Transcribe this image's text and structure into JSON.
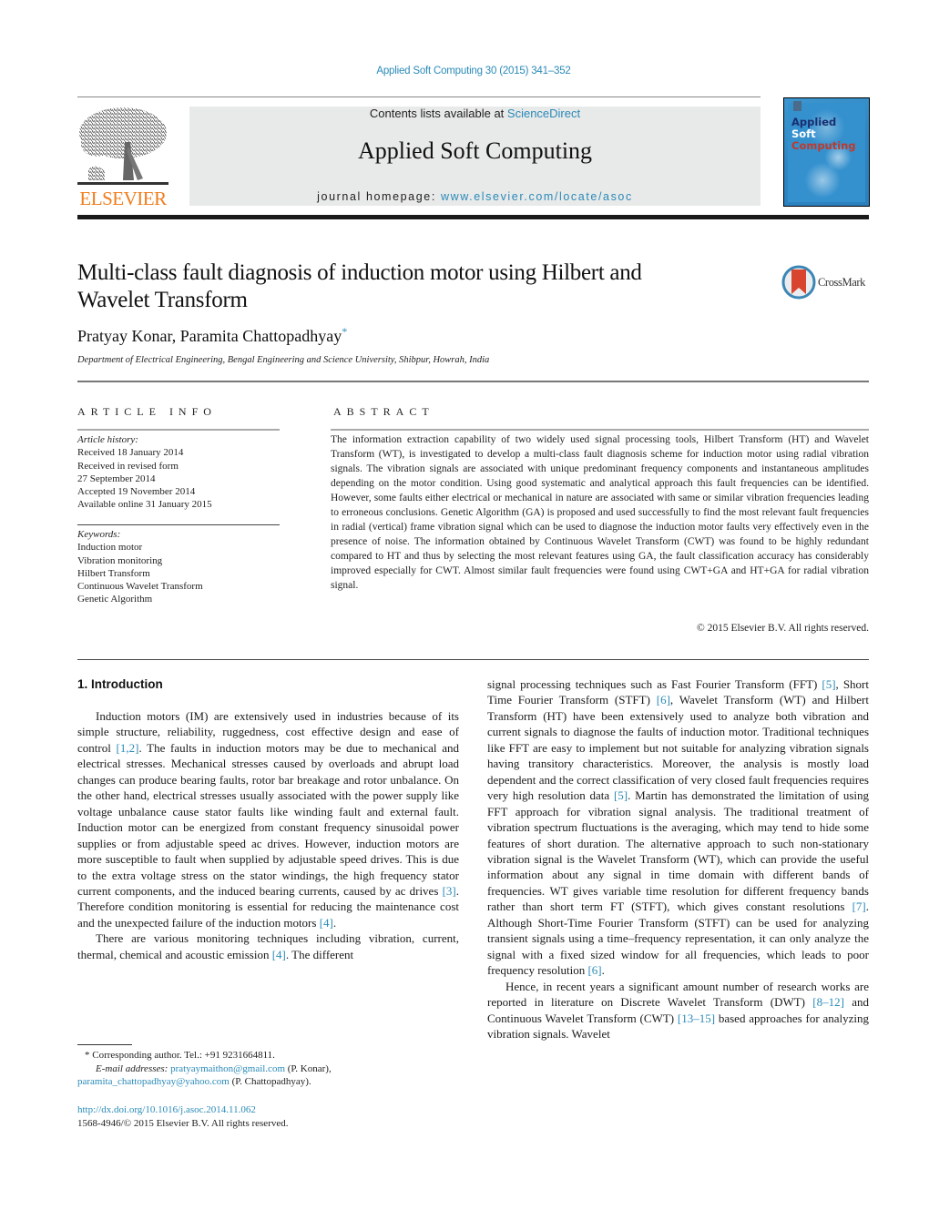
{
  "header": {
    "journal_reference": "Applied Soft Computing 30 (2015) 341–352",
    "contents_prefix": "Contents lists available at ",
    "contents_link": "ScienceDirect",
    "journal_name": "Applied Soft Computing",
    "homepage_prefix": "journal homepage: ",
    "homepage_link": "www.elsevier.com/locate/asoc",
    "publisher_logo_text": "ELSEVIER",
    "cover": {
      "line1": "Applied",
      "line2": "Soft",
      "line3": "Computing"
    },
    "crossmark_label": "CrossMark"
  },
  "article": {
    "title": "Multi-class fault diagnosis of induction motor using Hilbert and Wavelet Transform",
    "authors": "Pratyay Konar, Paramita Chattopadhyay",
    "corresponding_mark": "*",
    "affiliation": "Department of Electrical Engineering, Bengal Engineering and Science University, Shibpur, Howrah, India"
  },
  "article_info": {
    "heading": "ARTICLE INFO",
    "history_label": "Article history:",
    "history": [
      "Received 18 January 2014",
      "Received in revised form",
      "27 September 2014",
      "Accepted 19 November 2014",
      "Available online 31 January 2015"
    ],
    "keywords_label": "Keywords:",
    "keywords": [
      "Induction motor",
      "Vibration monitoring",
      "Hilbert Transform",
      "Continuous Wavelet Transform",
      "Genetic Algorithm"
    ]
  },
  "abstract": {
    "heading": "ABSTRACT",
    "text": "The information extraction capability of two widely used signal processing tools, Hilbert Transform (HT) and Wavelet Transform (WT), is investigated to develop a multi-class fault diagnosis scheme for induction motor using radial vibration signals. The vibration signals are associated with unique predominant frequency components and instantaneous amplitudes depending on the motor condition. Using good systematic and analytical approach this fault frequencies can be identified. However, some faults either electrical or mechanical in nature are associated with same or similar vibration frequencies leading to erroneous conclusions. Genetic Algorithm (GA) is proposed and used successfully to find the most relevant fault frequencies in radial (vertical) frame vibration signal which can be used to diagnose the induction motor faults very effectively even in the presence of noise. The information obtained by Continuous Wavelet Transform (CWT) was found to be highly redundant compared to HT and thus by selecting the most relevant features using GA, the fault classification accuracy has considerably improved especially for CWT. Almost similar fault frequencies were found using CWT+GA and HT+GA for radial vibration signal.",
    "copyright": "© 2015 Elsevier B.V. All rights reserved."
  },
  "body": {
    "section_heading": "1.  Introduction",
    "left_col": {
      "p1": [
        {
          "t": "Induction motors (IM) are extensively used in industries because of its simple structure, reliability, ruggedness, cost effective design and ease of control "
        },
        {
          "ref": "[1,2]"
        },
        {
          "t": ". The faults in induction motors may be due to mechanical and electrical stresses. Mechanical stresses caused by overloads and abrupt load changes can produce bearing faults, rotor bar breakage and rotor unbalance. On the other hand, electrical stresses usually associated with the power supply like voltage unbalance cause stator faults like winding fault and external fault. Induction motor can be energized from constant frequency sinusoidal power supplies or from adjustable speed ac drives. However, induction motors are more susceptible to fault when supplied by adjustable speed drives. This is due to the extra voltage stress on the stator windings, the high frequency stator current components, and the induced bearing currents, caused by ac drives "
        },
        {
          "ref": "[3]"
        },
        {
          "t": ". Therefore condition monitoring is essential for reducing the maintenance cost and the unexpected failure of the induction motors "
        },
        {
          "ref": "[4]"
        },
        {
          "t": "."
        }
      ],
      "p2": [
        {
          "t": "There are various monitoring techniques including vibration, current, thermal, chemical and acoustic emission "
        },
        {
          "ref": "[4]"
        },
        {
          "t": ". The different"
        }
      ]
    },
    "right_col": {
      "p1": [
        {
          "t": "signal processing techniques such as Fast Fourier Transform (FFT) "
        },
        {
          "ref": "[5]"
        },
        {
          "t": ", Short Time Fourier Transform (STFT) "
        },
        {
          "ref": "[6]"
        },
        {
          "t": ", Wavelet Transform (WT) and Hilbert Transform (HT) have been extensively used to analyze both vibration and current signals to diagnose the faults of induction motor. Traditional techniques like FFT are easy to implement but not suitable for analyzing vibration signals having transitory characteristics. Moreover, the analysis is mostly load dependent and the correct classification of very closed fault frequencies requires very high resolution data "
        },
        {
          "ref": "[5]"
        },
        {
          "t": ". Martin has demonstrated the limitation of using FFT approach for vibration signal analysis. The traditional treatment of vibration spectrum fluctuations is the averaging, which may tend to hide some features of short duration. The alternative approach to such non-stationary vibration signal is the Wavelet Transform (WT), which can provide the useful information about any signal in time domain with different bands of frequencies. WT gives variable time resolution for different frequency bands rather than short term FT (STFT), which gives constant resolutions "
        },
        {
          "ref": "[7]"
        },
        {
          "t": ". Although Short-Time Fourier Transform (STFT) can be used for analyzing transient signals using a time–frequency representation, it can only analyze the signal with a fixed sized window for all frequencies, which leads to poor frequency resolution "
        },
        {
          "ref": "[6]"
        },
        {
          "t": "."
        }
      ],
      "p2": [
        {
          "t": "Hence, in recent years a significant amount number of research works are reported in literature on Discrete Wavelet Transform (DWT) "
        },
        {
          "ref": "[8–12]"
        },
        {
          "t": " and Continuous Wavelet Transform (CWT) "
        },
        {
          "ref": "[13–15]"
        },
        {
          "t": " based approaches for analyzing vibration signals. Wavelet"
        }
      ]
    }
  },
  "footnotes": {
    "corresponding": "*  Corresponding author. Tel.: +91 9231664811.",
    "email_label": "E-mail addresses: ",
    "email1": "pratyaymaithon@gmail.com",
    "email1_owner": " (P. Konar),",
    "email2": "paramita_chattopadhyay@yahoo.com",
    "email2_owner": " (P. Chattopadhyay).",
    "doi": "http://dx.doi.org/10.1016/j.asoc.2014.11.062",
    "issn_copyright": "1568-4946/© 2015 Elsevier B.V. All rights reserved."
  },
  "colors": {
    "link": "#2a8ab8",
    "elsevier_orange": "#f07c1b",
    "masthead_bg": "#e8e9e9",
    "cover_blue": "#3591ce"
  }
}
